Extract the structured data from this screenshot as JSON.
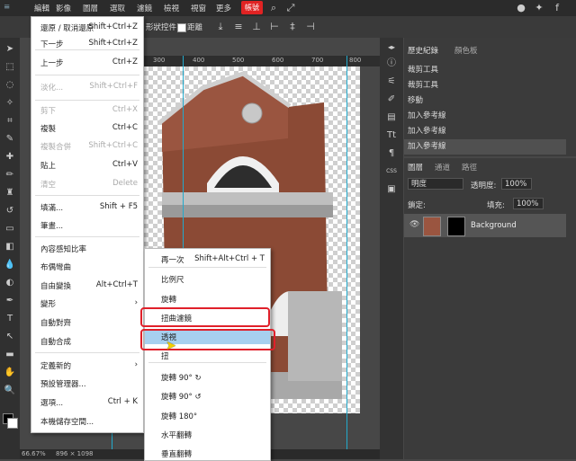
{
  "menubar": {
    "items": [
      "編輯",
      "檔案",
      "影像",
      "圖層",
      "選取",
      "濾鏡",
      "檢視",
      "視窗",
      "更多"
    ],
    "account_label": "帳號"
  },
  "options": {
    "transform_label": "形狀控件",
    "distance_label": "距離"
  },
  "ruler": {
    "ticks": [
      "300",
      "400",
      "500",
      "600",
      "700",
      "800"
    ]
  },
  "status": {
    "zoom": "66.67%",
    "size": "896 × 1098"
  },
  "edit_menu": {
    "items": [
      {
        "label": "還原 / 取消還原",
        "shortcut": "Shift+Ctrl+Z",
        "disabled": false
      },
      {
        "label": "下一步",
        "shortcut": "Shift+Ctrl+Z",
        "disabled": false
      },
      {
        "label": "上一步",
        "shortcut": "Ctrl+Z",
        "disabled": false
      },
      {
        "label": "淡化...",
        "shortcut": "Shift+Ctrl+F",
        "disabled": true
      },
      {
        "label": "剪下",
        "shortcut": "Ctrl+X",
        "disabled": true
      },
      {
        "label": "複製",
        "shortcut": "Ctrl+C",
        "disabled": false
      },
      {
        "label": "複製合併",
        "shortcut": "Shift+Ctrl+C",
        "disabled": true
      },
      {
        "label": "貼上",
        "shortcut": "Ctrl+V",
        "disabled": false
      },
      {
        "label": "清空",
        "shortcut": "Delete",
        "disabled": true
      },
      {
        "label": "填滿...",
        "shortcut": "Shift + F5",
        "disabled": false
      },
      {
        "label": "筆畫...",
        "shortcut": "",
        "disabled": false
      },
      {
        "label": "內容感知比率",
        "shortcut": "",
        "disabled": false
      },
      {
        "label": "布偶彎曲",
        "shortcut": "",
        "disabled": false
      },
      {
        "label": "自由變換",
        "shortcut": "Alt+Ctrl+T",
        "disabled": false
      },
      {
        "label": "變形",
        "shortcut": "›",
        "disabled": false
      },
      {
        "label": "自動對齊",
        "shortcut": "",
        "disabled": false
      },
      {
        "label": "自動合成",
        "shortcut": "",
        "disabled": false
      },
      {
        "label": "定義新的",
        "shortcut": "›",
        "disabled": false
      },
      {
        "label": "預設管理器...",
        "shortcut": "",
        "disabled": false
      },
      {
        "label": "選項...",
        "shortcut": "Ctrl + K",
        "disabled": false
      },
      {
        "label": "本機儲存空間...",
        "shortcut": "",
        "disabled": false
      }
    ]
  },
  "sub_menu": {
    "items": [
      {
        "label": "再一次",
        "shortcut": "Shift+Alt+Ctrl + T"
      },
      {
        "label": "比例尺",
        "shortcut": ""
      },
      {
        "label": "旋轉",
        "shortcut": ""
      },
      {
        "label": "扭曲濾鏡",
        "shortcut": ""
      },
      {
        "label": "透視",
        "shortcut": ""
      },
      {
        "label": "扭",
        "shortcut": ""
      },
      {
        "label": "旋轉 90° ↻",
        "shortcut": ""
      },
      {
        "label": "旋轉 90° ↺",
        "shortcut": ""
      },
      {
        "label": "旋轉 180°",
        "shortcut": ""
      },
      {
        "label": "水平翻轉",
        "shortcut": ""
      },
      {
        "label": "垂直翻轉",
        "shortcut": ""
      }
    ]
  },
  "history": {
    "tabs": [
      "歷史紀錄",
      "顏色板"
    ],
    "items": [
      "裁剪工具",
      "裁剪工具",
      "移動",
      "加入參考線",
      "加入參考線",
      "加入參考線"
    ]
  },
  "layers": {
    "tabs": [
      "圖層",
      "通道",
      "路徑"
    ],
    "blend_mode": "明度",
    "opacity_label": "透明度:",
    "opacity_value": "100%",
    "lock_label": "鎖定:",
    "fill_label": "填充:",
    "fill_value": "100%",
    "layer_name": "Background"
  }
}
